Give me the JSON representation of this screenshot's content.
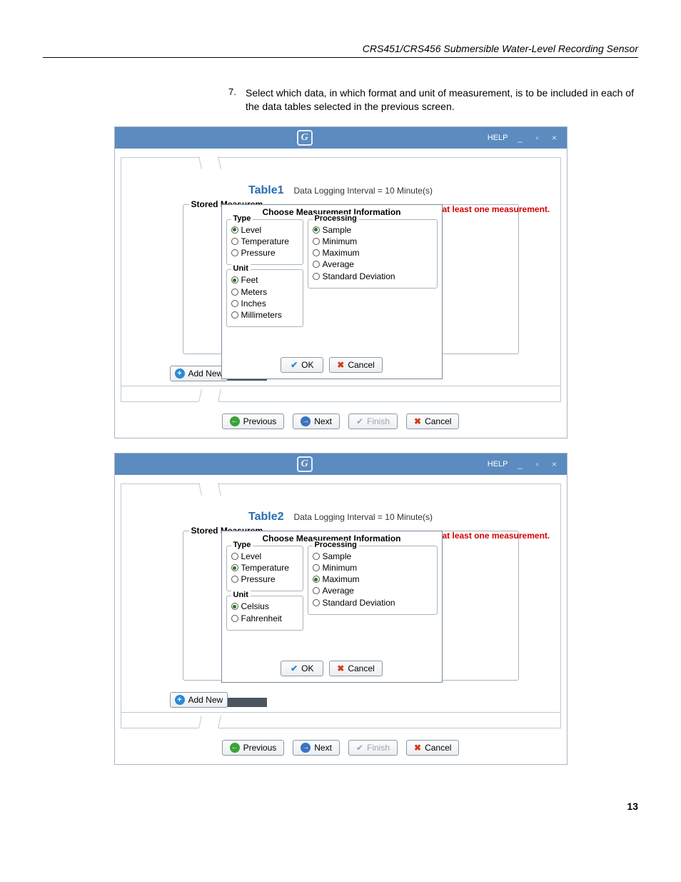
{
  "header": "CRS451/CRS456 Submersible Water-Level Recording Sensor",
  "step": {
    "num": "7.",
    "text": "Select which data, in which format and unit of measurement, is to be included in each of the data tables selected in the previous screen."
  },
  "titlebar": {
    "help": "HELP",
    "min": "_",
    "max": "▫",
    "close": "×"
  },
  "windows": [
    {
      "table_name": "Table1",
      "interval": "Data Logging Interval = 10 Minute(s)",
      "stored_legend": "Stored Measurem",
      "warning": "at least one measurement.",
      "dialog_title": "Choose Measurement Information",
      "type": {
        "legend": "Type",
        "options": [
          {
            "label": "Level",
            "selected": true
          },
          {
            "label": "Temperature",
            "selected": false
          },
          {
            "label": "Pressure",
            "selected": false
          }
        ]
      },
      "unit": {
        "legend": "Unit",
        "options": [
          {
            "label": "Feet",
            "selected": true
          },
          {
            "label": "Meters",
            "selected": false
          },
          {
            "label": "Inches",
            "selected": false
          },
          {
            "label": "Millimeters",
            "selected": false
          }
        ]
      },
      "processing": {
        "legend": "Processing",
        "options": [
          {
            "label": "Sample",
            "selected": true
          },
          {
            "label": "Minimum",
            "selected": false
          },
          {
            "label": "Maximum",
            "selected": false
          },
          {
            "label": "Average",
            "selected": false
          },
          {
            "label": "Standard Deviation",
            "selected": false
          }
        ]
      }
    },
    {
      "table_name": "Table2",
      "interval": "Data Logging Interval = 10 Minute(s)",
      "stored_legend": "Stored Measurem",
      "warning": "at least one measurement.",
      "dialog_title": "Choose Measurement Information",
      "type": {
        "legend": "Type",
        "options": [
          {
            "label": "Level",
            "selected": false
          },
          {
            "label": "Temperature",
            "selected": true
          },
          {
            "label": "Pressure",
            "selected": false
          }
        ]
      },
      "unit": {
        "legend": "Unit",
        "options": [
          {
            "label": "Celsius",
            "selected": true
          },
          {
            "label": "Fahrenheit",
            "selected": false
          }
        ]
      },
      "processing": {
        "legend": "Processing",
        "options": [
          {
            "label": "Sample",
            "selected": false
          },
          {
            "label": "Minimum",
            "selected": false
          },
          {
            "label": "Maximum",
            "selected": true
          },
          {
            "label": "Average",
            "selected": false
          },
          {
            "label": "Standard Deviation",
            "selected": false
          }
        ]
      }
    }
  ],
  "buttons": {
    "ok": "OK",
    "cancel": "Cancel",
    "add_new": "Add New",
    "previous": "Previous",
    "next": "Next",
    "finish": "Finish"
  },
  "page_number": "13"
}
